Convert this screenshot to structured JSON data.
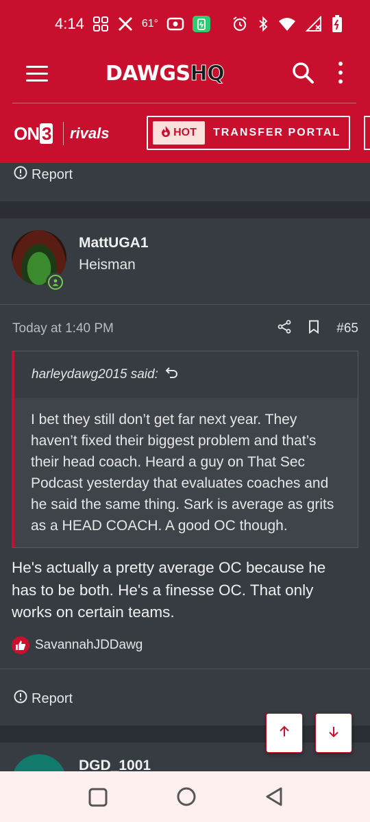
{
  "status_bar": {
    "time": "4:14",
    "temperature": "61°",
    "icons": [
      "grid-icon",
      "x-logo-icon",
      "radio-icon",
      "battery-saver-icon",
      "alarm-icon",
      "bluetooth-icon",
      "wifi-icon",
      "signal-icon",
      "battery-icon"
    ]
  },
  "header": {
    "brand_main": "DAWGS",
    "brand_accent": "HQ",
    "brand_color": "#c8102e"
  },
  "subheader": {
    "on3_prefix": "ON",
    "on3_num": "3",
    "rivals": "rivals",
    "hot_label": "HOT",
    "portal_label": "TRANSFER PORTAL"
  },
  "prev_post": {
    "report_label": "Report"
  },
  "post": {
    "username": "MattUGA1",
    "user_title": "Heisman",
    "time": "Today at 1:40 PM",
    "post_number": "#65",
    "quote": {
      "author_line": "harleydawg2015 said:",
      "text": "I bet they still don’t get far next year. They haven’t fixed their biggest problem and that’s their head coach. Heard a guy on That Sec Podcast yesterday that evaluates coaches and he said the same thing. Sark is average as grits as a HEAD COACH. A good OC though."
    },
    "body": "He's actually a pretty average OC because he has to be both. He's a finesse OC. That only works on certain teams.",
    "reaction_user": "SavannahJDDawg",
    "report_label": "Report"
  },
  "next_post": {
    "username": "DGD_1001"
  }
}
